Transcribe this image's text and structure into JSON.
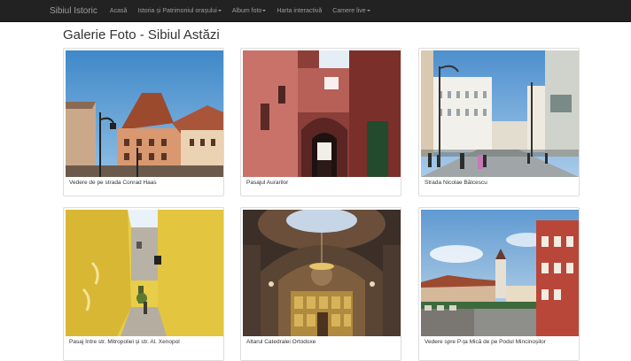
{
  "navbar": {
    "brand": "Sibiul Istoric",
    "items": [
      {
        "label": "Acasă",
        "dropdown": false
      },
      {
        "label": "Istoria și Patrimoniul orașului",
        "dropdown": true
      },
      {
        "label": "Album foto",
        "dropdown": true
      },
      {
        "label": "Harta interactivă",
        "dropdown": false
      },
      {
        "label": "Camere live",
        "dropdown": true
      }
    ]
  },
  "page": {
    "title": "Galerie Foto - Sibiul Astăzi"
  },
  "gallery": [
    {
      "caption": "Vedere de pe strada Conrad Haas",
      "icon": "photo-conrad-haas"
    },
    {
      "caption": "Pasajul Aurarilor",
      "icon": "photo-pasajul-aurarilor"
    },
    {
      "caption": "Strada Nicolae Bălcescu",
      "icon": "photo-balcescu"
    },
    {
      "caption": "Pasaj între str. Mitropoliei și str. Al. Xenopol",
      "icon": "photo-pasaj-mitropoliei"
    },
    {
      "caption": "Altarul Catedralei Ortodoxe",
      "icon": "photo-catedrala"
    },
    {
      "caption": "Vedere spre P-ța Mică de pe Podul Mincinoșilor",
      "icon": "photo-piata-mica"
    }
  ],
  "colors": {
    "navbar_bg": "#222222",
    "navbar_text": "#9d9d9d",
    "title": "#333333",
    "border": "#dddddd"
  }
}
